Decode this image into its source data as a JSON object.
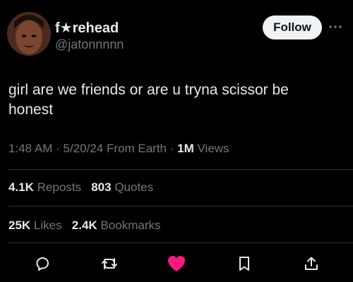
{
  "header": {
    "display_name": "f★rehead",
    "handle": "@jatonnnnn",
    "follow_label": "Follow"
  },
  "tweet": {
    "text": "girl are we friends or are u tryna scissor be honest"
  },
  "meta": {
    "time": "1:48 AM",
    "date": "5/20/24",
    "source": "From Earth",
    "views_count": "1M",
    "views_label": "Views",
    "separator": "·"
  },
  "stats": {
    "reposts_count": "4.1K",
    "reposts_label": "Reposts",
    "quotes_count": "803",
    "quotes_label": "Quotes",
    "likes_count": "25K",
    "likes_label": "Likes",
    "bookmarks_count": "2.4K",
    "bookmarks_label": "Bookmarks"
  },
  "actions": {
    "reply_icon": "reply-icon",
    "repost_icon": "repost-icon",
    "like_icon": "heart-icon",
    "bookmark_icon": "bookmark-icon",
    "share_icon": "share-icon"
  },
  "colors": {
    "background": "#000000",
    "text_primary": "#e7e9ea",
    "text_secondary": "#71767b",
    "divider": "#2f3336",
    "like_active": "#f91880",
    "follow_bg": "#eff3f4"
  }
}
